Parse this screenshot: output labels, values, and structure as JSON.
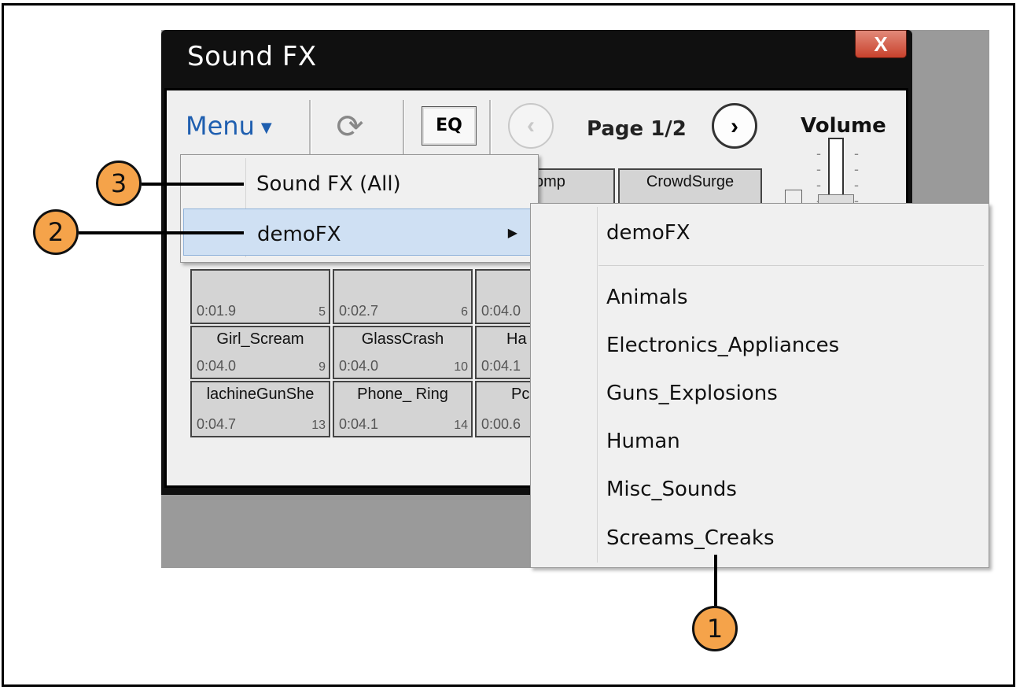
{
  "window": {
    "title": "Sound FX",
    "close_glyph": "X"
  },
  "toolbar": {
    "menu_label": "Menu",
    "menu_caret": "▼",
    "refresh_glyph": "⟳",
    "eq_label": "EQ",
    "prev_glyph": "‹",
    "next_glyph": "›",
    "page_label": "Page 1/2",
    "volume_label": "Volume"
  },
  "grid": {
    "row1": [
      {
        "name": "",
        "dur": "",
        "num": ""
      },
      {
        "name": "",
        "dur": "",
        "num": ""
      },
      {
        "name": "omp",
        "dur": "",
        "num": ""
      },
      {
        "name": "CrowdSurge",
        "dur": "",
        "num": ""
      }
    ],
    "row2": [
      {
        "name": "",
        "dur": "0:01.9",
        "num": "5"
      },
      {
        "name": "",
        "dur": "0:02.7",
        "num": "6"
      },
      {
        "name": "",
        "dur": "0:04.0",
        "num": ""
      }
    ],
    "row3": [
      {
        "name": "Girl_Scream",
        "dur": "0:04.0",
        "num": "9"
      },
      {
        "name": "GlassCrash",
        "dur": "0:04.0",
        "num": "10"
      },
      {
        "name": "Ha",
        "dur": "0:04.1",
        "num": ""
      }
    ],
    "row4": [
      {
        "name": "lachineGunShe",
        "dur": "0:04.7",
        "num": "13"
      },
      {
        "name": "Phone_ Ring",
        "dur": "0:04.1",
        "num": "14"
      },
      {
        "name": "Pc",
        "dur": "0:00.6",
        "num": ""
      }
    ]
  },
  "menu": {
    "items": [
      {
        "label": "Sound FX (All)"
      },
      {
        "label": "demoFX",
        "arrow": "▶"
      }
    ]
  },
  "submenu": {
    "header": "demoFX",
    "items": [
      "Animals",
      "Electronics_Appliances",
      "Guns_Explosions",
      "Human",
      "Misc_Sounds",
      "Screams_Creaks"
    ]
  },
  "callouts": [
    "1",
    "2",
    "3"
  ],
  "colors": {
    "callout": "#f5a34a",
    "menu_highlight": "#cfe0f3",
    "menu_text": "#1f5fb0"
  }
}
